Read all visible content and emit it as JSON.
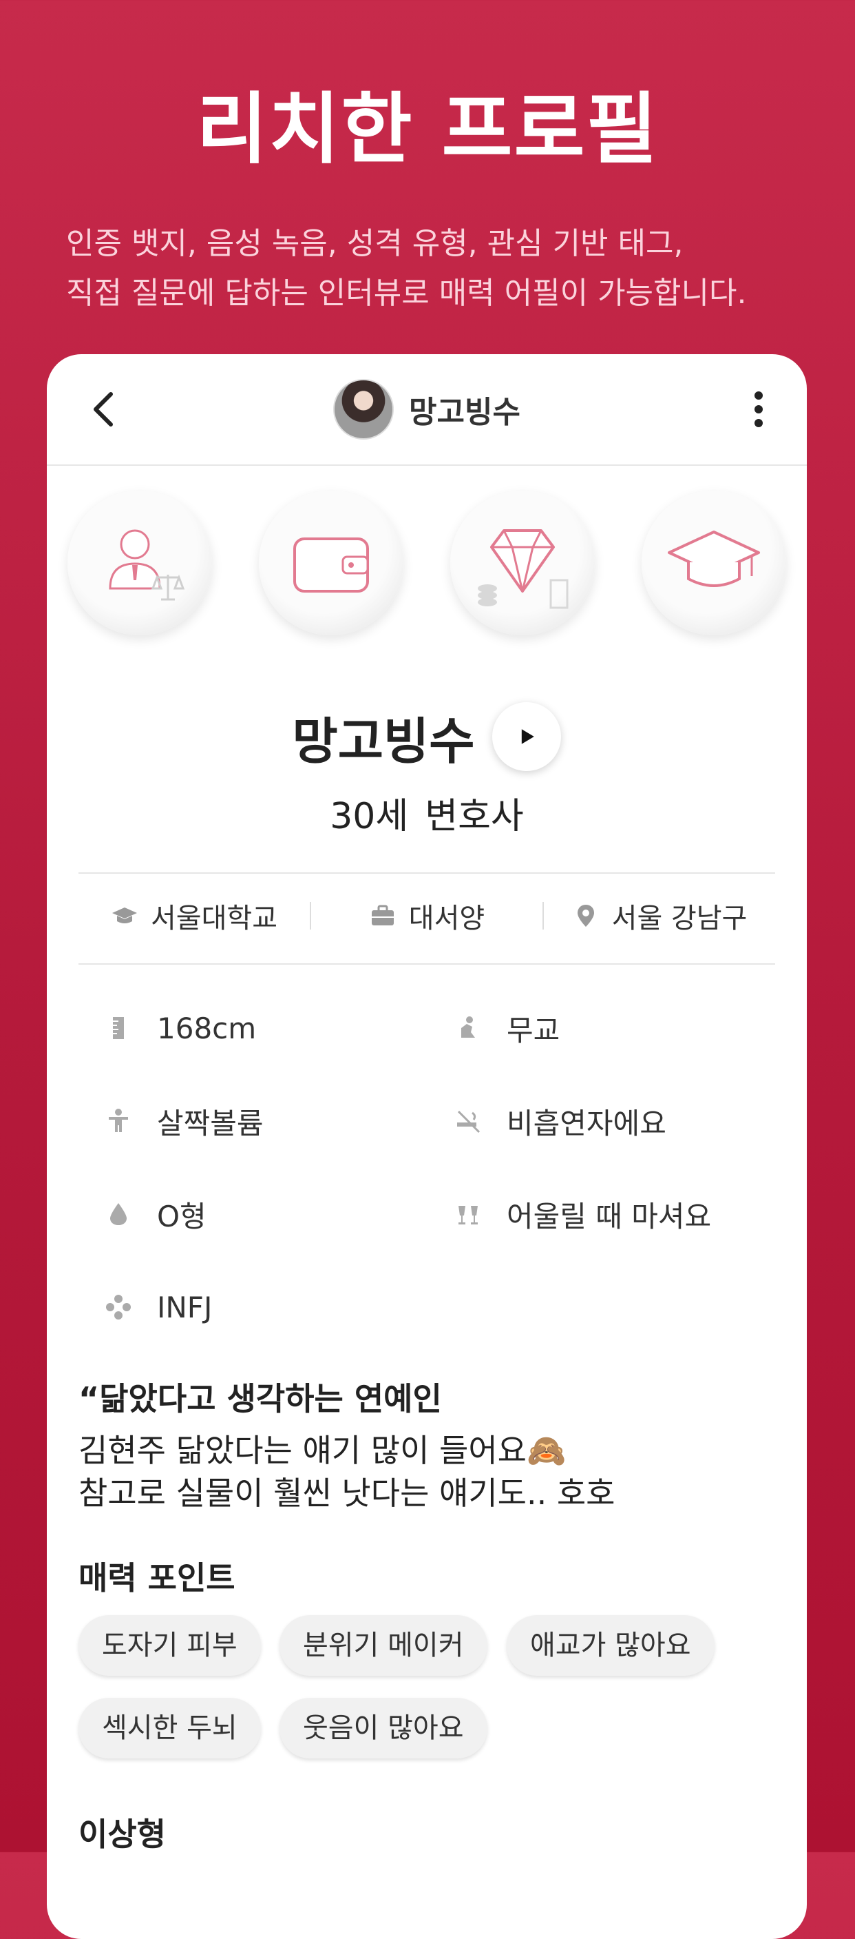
{
  "hero": {
    "title": "리치한 프로필",
    "desc_line1": "인증 뱃지, 음성 녹음, 성격 유형, 관심 기반 태그,",
    "desc_line2": "직접 질문에 답하는 인터뷰로 매력 어필이 가능합니다."
  },
  "topbar": {
    "name": "망고빙수",
    "back_icon": "chevron-left-icon",
    "more_icon": "kebab-menu-icon"
  },
  "badges": [
    {
      "icon": "lawyer-badge-icon"
    },
    {
      "icon": "wallet-badge-icon"
    },
    {
      "icon": "diamond-badge-icon"
    },
    {
      "icon": "graduation-badge-icon"
    }
  ],
  "profile": {
    "name": "망고빙수",
    "age": "30세",
    "job": "변호사"
  },
  "meta": {
    "school": "서울대학교",
    "company": "대서양",
    "location": "서울 강남구"
  },
  "attributes": {
    "height": "168cm",
    "religion": "무교",
    "body": "살짝볼륨",
    "smoking": "비흡연자에요",
    "blood": "O형",
    "drinking": "어울릴 때 마셔요",
    "mbti": "INFJ"
  },
  "quote": {
    "mark": "“",
    "title": "닮았다고 생각하는 연예인",
    "line1": "김현주 닮았다는 얘기 많이 들어요🙈",
    "line2": "참고로 실물이 훨씬 낫다는 얘기도.. 호호"
  },
  "charm": {
    "title": "매력 포인트",
    "tags": [
      "도자기 피부",
      "분위기 메이커",
      "애교가 많아요",
      "섹시한 두뇌",
      "웃음이 많아요"
    ]
  },
  "ideal": {
    "title": "이상형"
  },
  "colors": {
    "accent": "#c72a4b",
    "badge_pink": "#e27a90"
  }
}
